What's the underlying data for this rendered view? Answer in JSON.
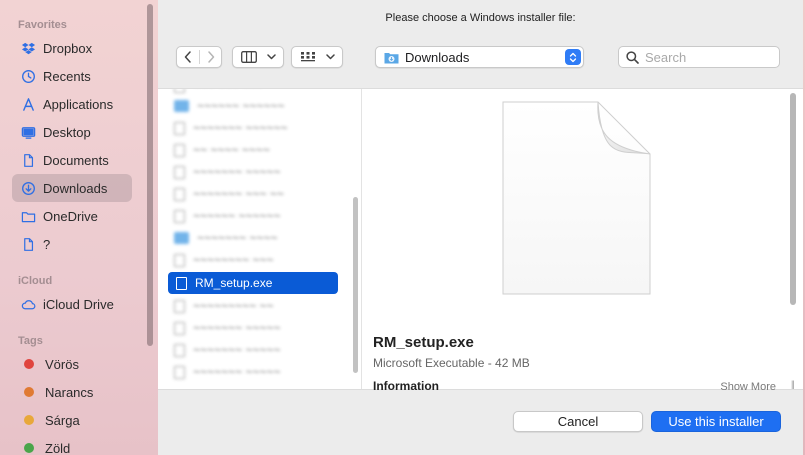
{
  "sidebar": {
    "favorites_label": "Favorites",
    "favorites": [
      {
        "label": "Dropbox",
        "icon": "dropbox-icon"
      },
      {
        "label": "Recents",
        "icon": "clock-icon"
      },
      {
        "label": "Applications",
        "icon": "applications-icon"
      },
      {
        "label": "Desktop",
        "icon": "desktop-icon"
      },
      {
        "label": "Documents",
        "icon": "document-icon"
      },
      {
        "label": "Downloads",
        "icon": "download-icon",
        "active": true
      },
      {
        "label": "OneDrive",
        "icon": "folder-icon"
      },
      {
        "label": "?",
        "icon": "document-icon"
      }
    ],
    "icloud_label": "iCloud",
    "icloud": [
      {
        "label": "iCloud Drive",
        "icon": "cloud-icon"
      }
    ],
    "tags_label": "Tags",
    "tags": [
      {
        "label": "Vörös",
        "color": "#e0443e"
      },
      {
        "label": "Narancs",
        "color": "#e07a33"
      },
      {
        "label": "Sárga",
        "color": "#e8a83a"
      },
      {
        "label": "Zöld",
        "color": "#4aa54a"
      }
    ]
  },
  "dialog": {
    "title": "Please choose a Windows installer file:",
    "location": "Downloads",
    "search_placeholder": "Search",
    "selected_file": "RM_setup.exe",
    "preview": {
      "name": "RM_setup.exe",
      "kind": "Microsoft Executable - 42 MB",
      "info_label": "Information",
      "show_more": "Show More"
    },
    "cancel_label": "Cancel",
    "confirm_label": "Use this installer"
  },
  "colors": {
    "accent": "#1e6ff2",
    "selection": "#0a5bd6"
  }
}
